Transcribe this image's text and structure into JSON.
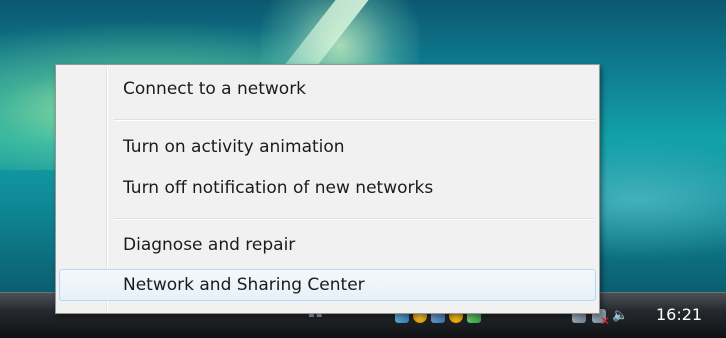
{
  "context_menu": {
    "items": [
      {
        "label": "Connect to a network"
      },
      {
        "label": "Turn on activity animation"
      },
      {
        "label": "Turn off notification of new networks"
      },
      {
        "label": "Diagnose and repair"
      },
      {
        "label": "Network and Sharing Center",
        "highlighted": true
      }
    ]
  },
  "taskbar": {
    "clock": "16:21",
    "tray_icons": [
      "network-icon",
      "shield-icon",
      "update-icon",
      "warning-icon",
      "check-icon",
      "network-status-icon",
      "network-disconnected-icon",
      "volume-icon"
    ]
  },
  "colors": {
    "menu_background": "#f1f1f1",
    "menu_highlight_border": "#b8d6fb",
    "taskbar_top": "#4b5157",
    "taskbar_bottom": "#0f1214",
    "disconnected_x": "#e0211b"
  }
}
